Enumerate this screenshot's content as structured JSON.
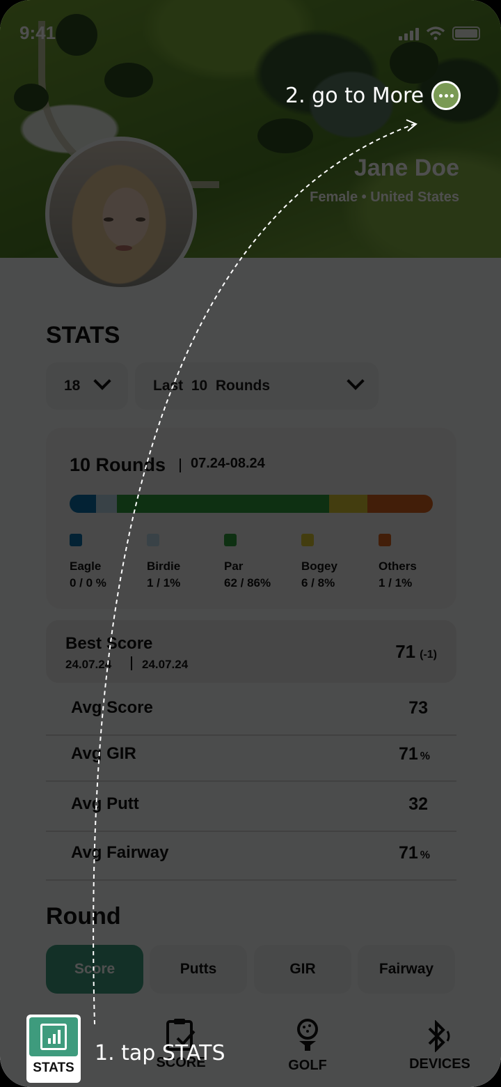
{
  "status_bar": {
    "time": "9:41"
  },
  "profile": {
    "name": "Jane Doe",
    "subtitle": "Female • United States"
  },
  "stats": {
    "title": "STATS",
    "holes_select": "18",
    "rounds_select": "Last  10  Rounds"
  },
  "summary": {
    "rounds_label": "10 Rounds",
    "date_range": "07.24-08.24",
    "distribution": [
      {
        "label": "Eagle",
        "value": "0 / 0 %",
        "color": "#0c6fa8",
        "share": 0.072
      },
      {
        "label": "Birdie",
        "value": "1 / 1%",
        "color": "#b7d5e6",
        "share": 0.058
      },
      {
        "label": "Par",
        "value": "62 / 86%",
        "color": "#2f9a3a",
        "share": 0.585
      },
      {
        "label": "Bogey",
        "value": "6 / 8%",
        "color": "#d9c532",
        "share": 0.105
      },
      {
        "label": "Others",
        "value": "1 / 1%",
        "color": "#d4611e",
        "share": 0.18
      }
    ]
  },
  "best_score": {
    "label": "Best Score",
    "date_from": "24.07.24",
    "date_to": "24.07.24",
    "value": "71",
    "delta": "(-1)"
  },
  "averages": [
    {
      "label": "Avg Score",
      "value": "73",
      "unit": ""
    },
    {
      "label": "Avg GIR",
      "value": "71",
      "unit": "%"
    },
    {
      "label": "Avg Putt",
      "value": "32",
      "unit": ""
    },
    {
      "label": "Avg Fairway",
      "value": "71",
      "unit": "%"
    }
  ],
  "round": {
    "title": "Round",
    "tabs": [
      "Score",
      "Putts",
      "GIR",
      "Fairway"
    ],
    "active_tab": "Score"
  },
  "bottom_nav": {
    "items": [
      {
        "label": "STATS",
        "icon": "chart-icon"
      },
      {
        "label": "SCORE",
        "icon": "clipboard-check-icon"
      },
      {
        "label": "GOLF",
        "icon": "golf-ball-tee-icon"
      },
      {
        "label": "DEVICES",
        "icon": "bluetooth-icon"
      }
    ]
  },
  "tutorial": {
    "step1": "1. tap STATS",
    "step2": "2. go to More"
  },
  "colors": {
    "accent": "#3e9b7d",
    "overlay": "rgba(0,0,0,0.69)"
  }
}
